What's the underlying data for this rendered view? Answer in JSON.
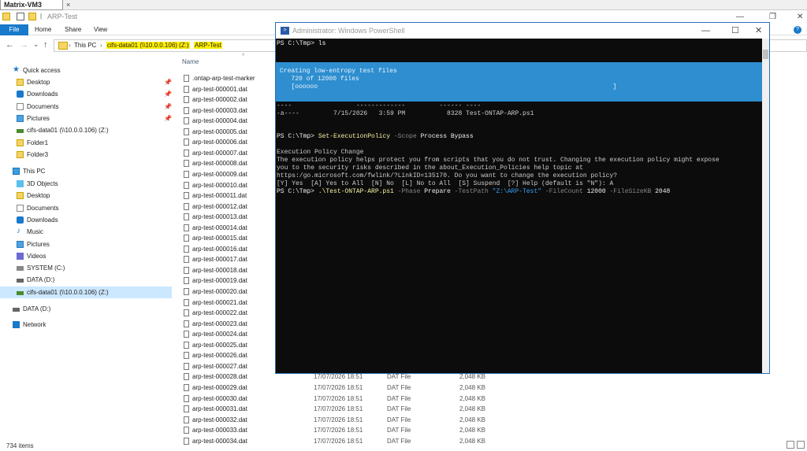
{
  "vm": {
    "tab": "Matrix-VM3",
    "close": "×"
  },
  "window": {
    "title": "ARP-Test",
    "min": "—",
    "max": "❐",
    "close": "✕"
  },
  "ribbon": {
    "tabs": [
      "File",
      "Home",
      "Share",
      "View"
    ],
    "help": "?"
  },
  "address": {
    "pc": "This PC",
    "drive": "cifs-data01 (\\\\10.0.0.106) (Z:)",
    "folder": "ARP-Test",
    "sep": "›",
    "back": "←",
    "forward": "→",
    "recent": "⌄",
    "up": "↑"
  },
  "sidebar": {
    "items": [
      {
        "label": "Quick access",
        "icon": "star-icon"
      },
      {
        "label": "Desktop",
        "icon": "folder-icon"
      },
      {
        "label": "Downloads",
        "icon": "download-icon"
      },
      {
        "label": "Documents",
        "icon": "documents-icon"
      },
      {
        "label": "Pictures",
        "icon": "pictures-icon"
      },
      {
        "label": "cifs-data01 (\\\\10.0.0.106) (Z:)",
        "icon": "network-drive-icon"
      },
      {
        "label": "Folder1",
        "icon": "folder-icon"
      },
      {
        "label": "Folder3",
        "icon": "folder-icon"
      },
      {
        "label": "This PC",
        "icon": "pc-icon"
      },
      {
        "label": "3D Objects",
        "icon": "3d-objects-icon"
      },
      {
        "label": "Desktop",
        "icon": "folder-icon"
      },
      {
        "label": "Documents",
        "icon": "documents-icon"
      },
      {
        "label": "Downloads",
        "icon": "download-icon"
      },
      {
        "label": "Music",
        "icon": "music-icon"
      },
      {
        "label": "Pictures",
        "icon": "pictures-icon"
      },
      {
        "label": "Videos",
        "icon": "videos-icon"
      },
      {
        "label": "SYSTEM (C:)",
        "icon": "system-drive-icon"
      },
      {
        "label": "DATA (D:)",
        "icon": "drive-icon"
      },
      {
        "label": "cifs-data01 (\\\\10.0.0.106) (Z:)",
        "icon": "network-drive-icon"
      },
      {
        "label": "DATA (D:)",
        "icon": "drive-icon"
      },
      {
        "label": "Network",
        "icon": "network-icon"
      }
    ]
  },
  "filelist": {
    "column_name": "Name",
    "sort_arrow": "^",
    "files": [
      {
        "name": ".ontap-arp-test-marker"
      },
      {
        "name": "arp-test-000001.dat"
      },
      {
        "name": "arp-test-000002.dat"
      },
      {
        "name": "arp-test-000003.dat"
      },
      {
        "name": "arp-test-000004.dat"
      },
      {
        "name": "arp-test-000005.dat"
      },
      {
        "name": "arp-test-000006.dat"
      },
      {
        "name": "arp-test-000007.dat"
      },
      {
        "name": "arp-test-000008.dat"
      },
      {
        "name": "arp-test-000009.dat"
      },
      {
        "name": "arp-test-000010.dat"
      },
      {
        "name": "arp-test-000011.dat"
      },
      {
        "name": "arp-test-000012.dat"
      },
      {
        "name": "arp-test-000013.dat"
      },
      {
        "name": "arp-test-000014.dat"
      },
      {
        "name": "arp-test-000015.dat"
      },
      {
        "name": "arp-test-000016.dat"
      },
      {
        "name": "arp-test-000017.dat"
      },
      {
        "name": "arp-test-000018.dat"
      },
      {
        "name": "arp-test-000019.dat"
      },
      {
        "name": "arp-test-000020.dat"
      },
      {
        "name": "arp-test-000021.dat"
      },
      {
        "name": "arp-test-000022.dat"
      },
      {
        "name": "arp-test-000023.dat"
      },
      {
        "name": "arp-test-000024.dat"
      },
      {
        "name": "arp-test-000025.dat"
      },
      {
        "name": "arp-test-000026.dat"
      },
      {
        "name": "arp-test-000027.dat"
      },
      {
        "name": "arp-test-000028.dat",
        "date": "17/07/2026 18:51",
        "type": "DAT File",
        "size": "2,048 KB"
      },
      {
        "name": "arp-test-000029.dat",
        "date": "17/07/2026 18:51",
        "type": "DAT File",
        "size": "2,048 KB"
      },
      {
        "name": "arp-test-000030.dat",
        "date": "17/07/2026 18:51",
        "type": "DAT File",
        "size": "2,048 KB"
      },
      {
        "name": "arp-test-000031.dat",
        "date": "17/07/2026 18:51",
        "type": "DAT File",
        "size": "2,048 KB"
      },
      {
        "name": "arp-test-000032.dat",
        "date": "17/07/2026 18:51",
        "type": "DAT File",
        "size": "2,048 KB"
      },
      {
        "name": "arp-test-000033.dat",
        "date": "17/07/2026 18:51",
        "type": "DAT File",
        "size": "2,048 KB"
      },
      {
        "name": "arp-test-000034.dat",
        "date": "17/07/2026 18:51",
        "type": "DAT File",
        "size": "2,048 KB"
      }
    ]
  },
  "status": {
    "items": "734 items"
  },
  "powershell": {
    "title": "Administrator: Windows PowerShell",
    "min": "—",
    "max": "☐",
    "close": "✕",
    "line1": "PS C:\\Tmp> ls",
    "progress_title": "Creating low-entropy test files",
    "progress_status": "   720 of 12000 files",
    "progress_bar": "   [oooooo                                                                              ]",
    "dir_dashes": "----                 -------------         ------ ----",
    "dir_row": "-a----         7/15/2026   3:59 PM           8328 Test-ONTAP-ARP.ps1",
    "prompt2": "PS C:\\Tmp> ",
    "cmd2": "Set-ExecutionPolicy",
    "arg2a": " -Scope",
    "arg2b": " Process Bypass",
    "ep_title": "Execution Policy Change",
    "ep_1": "The execution policy helps protect you from scripts that you do not trust. Changing the execution policy might expose",
    "ep_2": "you to the security risks described in the about_Execution_Policies help topic at",
    "ep_3": "https:/go.microsoft.com/fwlink/?LinkID=135170. Do you want to change the execution policy?",
    "ep_4": "[Y] Yes  [A] Yes to All  [N] No  [L] No to All  [S] Suspend  [?] Help (default is \"N\"): A",
    "prompt3": "PS C:\\Tmp> ",
    "cmd3": ".\\Test-ONTAP-ARP.ps1",
    "p3a": " -Phase",
    "p3b": " Prepare",
    "p3c": " -TestPath",
    "p3d": " \"Z:\\ARP-Test\"",
    "p3e": " -FileCount",
    "p3f": " 12000",
    "p3g": " -FileSizeKB",
    "p3h": " 2048"
  }
}
